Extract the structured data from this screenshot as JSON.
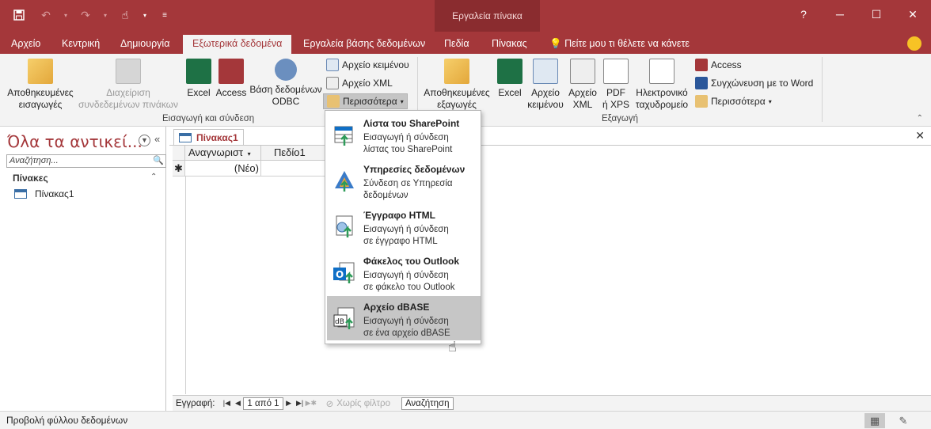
{
  "context_title": "Εργαλεία πίνακα",
  "window_controls": {
    "help": "?",
    "minimize": "─",
    "maximize": "☐",
    "close": "✕"
  },
  "tabs": [
    "Αρχείο",
    "Κεντρική",
    "Δημιουργία",
    "Εξωτερικά δεδομένα",
    "Εργαλεία βάσης δεδομένων",
    "Πεδία",
    "Πίνακας"
  ],
  "tell_me": "Πείτε μου τι θέλετε να κάνετε",
  "ribbon": {
    "import": {
      "saved_imports": [
        "Αποθηκευμένες",
        "εισαγωγές"
      ],
      "linked_table_manager": [
        "Διαχείριση",
        "συνδεδεμένων πινάκων"
      ],
      "excel": "Excel",
      "access": "Access",
      "odbc": [
        "Βάση δεδομένων",
        "ODBC"
      ],
      "text_file": "Αρχείο κειμένου",
      "xml_file": "Αρχείο XML",
      "more": "Περισσότερα",
      "group_label": "Εισαγωγή και σύνδεση"
    },
    "export": {
      "saved_exports": [
        "Αποθηκευμένες",
        "εξαγωγές"
      ],
      "excel": "Excel",
      "text_file": [
        "Αρχείο",
        "κειμένου"
      ],
      "xml_file": [
        "Αρχείο",
        "XML"
      ],
      "pdf": [
        "PDF",
        "ή XPS"
      ],
      "email": [
        "Ηλεκτρονικό",
        "ταχυδρομείο"
      ],
      "access": "Access",
      "word_merge": "Συγχώνευση με το Word",
      "more": "Περισσότερα",
      "group_label": "Εξαγωγή"
    }
  },
  "nav": {
    "title": "Όλα τα αντικεί...",
    "search_placeholder": "Αναζήτηση...",
    "group": "Πίνακες",
    "items": [
      "Πίνακας1"
    ]
  },
  "document": {
    "tab": "Πίνακας1",
    "columns": [
      "Αναγνωριστ",
      "Πεδίο1"
    ],
    "new_row_label": "(Νέο)",
    "new_row_marker": "✱"
  },
  "record_nav": {
    "label": "Εγγραφή:",
    "position": "1 από 1",
    "filter": "Χωρίς φίλτρο",
    "search": "Αναζήτηση"
  },
  "status": {
    "text": "Προβολή φύλλου δεδομένων"
  },
  "menu": [
    {
      "title": "Λίστα του SharePoint",
      "desc1": "Εισαγωγή ή σύνδεση",
      "desc2": "λίστας του SharePoint",
      "icon": "sharepoint-list-icon"
    },
    {
      "title": "Υπηρεσίες δεδομένων",
      "desc1": "Σύνδεση σε Υπηρεσία",
      "desc2": "δεδομένων",
      "icon": "data-services-icon"
    },
    {
      "title": "Έγγραφο HTML",
      "desc1": "Εισαγωγή ή σύνδεση",
      "desc2": "σε έγγραφο HTML",
      "icon": "html-document-icon"
    },
    {
      "title": "Φάκελος του Outlook",
      "desc1": "Εισαγωγή ή σύνδεση",
      "desc2": "σε φάκελο του Outlook",
      "icon": "outlook-folder-icon"
    },
    {
      "title": "Αρχείο dBASE",
      "desc1": "Εισαγωγή ή σύνδεση",
      "desc2": "σε ένα αρχείο dBASE",
      "icon": "dbase-file-icon"
    }
  ],
  "colors": {
    "accent": "#a4373a",
    "ribbon_bg": "#f3f3f3",
    "hover": "#c6c6c6"
  }
}
